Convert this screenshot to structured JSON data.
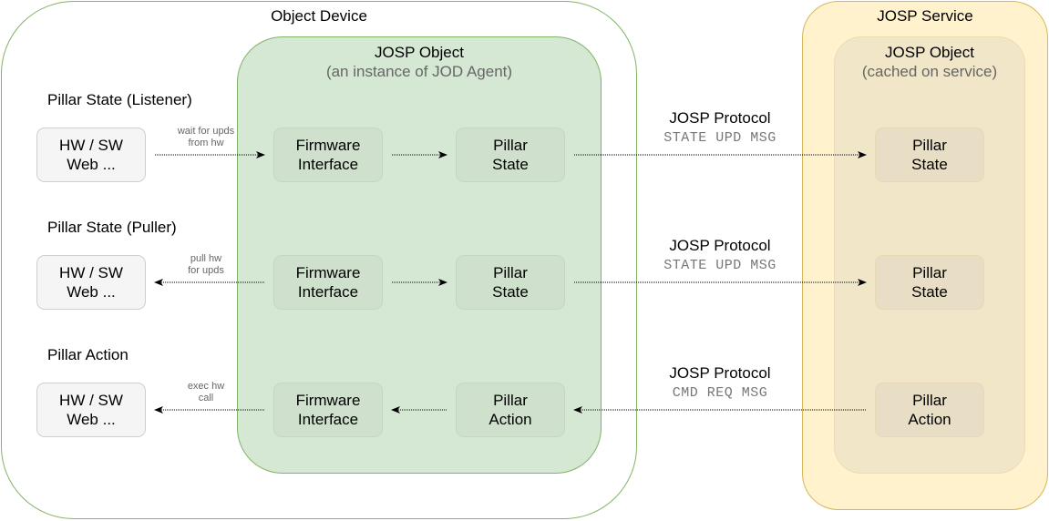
{
  "object_device": {
    "title": "Object Device"
  },
  "jod_object": {
    "title": "JOSP Object",
    "subtitle": "(an instance of JOD Agent)"
  },
  "service": {
    "title": "JOSP Service"
  },
  "cached_object": {
    "title": "JOSP Object",
    "subtitle": "(cached on service)"
  },
  "rows": [
    {
      "section": "Pillar State (Listener)",
      "hw": [
        "HW / SW",
        "Web ..."
      ],
      "hw_edge": [
        "wait for upds",
        "from hw"
      ],
      "hw_edge_direction": "to-firmware",
      "firmware": [
        "Firmware",
        "Interface"
      ],
      "pillar": [
        "Pillar",
        "State"
      ],
      "protocol": "JOSP Protocol",
      "message": "STATE UPD MSG",
      "protocol_direction": "to-service",
      "service_pillar": [
        "Pillar",
        "State"
      ]
    },
    {
      "section": "Pillar State (Puller)",
      "hw": [
        "HW / SW",
        "Web ..."
      ],
      "hw_edge": [
        "pull hw",
        "for upds"
      ],
      "hw_edge_direction": "to-hw",
      "firmware": [
        "Firmware",
        "Interface"
      ],
      "pillar": [
        "Pillar",
        "State"
      ],
      "protocol": "JOSP Protocol",
      "message": "STATE UPD MSG",
      "protocol_direction": "to-service",
      "service_pillar": [
        "Pillar",
        "State"
      ]
    },
    {
      "section": "Pillar Action",
      "hw": [
        "HW / SW",
        "Web ..."
      ],
      "hw_edge": [
        "exec hw",
        "call"
      ],
      "hw_edge_direction": "to-hw",
      "firmware": [
        "Firmware",
        "Interface"
      ],
      "pillar": [
        "Pillar",
        "Action"
      ],
      "protocol": "JOSP Protocol",
      "message": "CMD REQ MSG",
      "protocol_direction": "to-device",
      "service_pillar": [
        "Pillar",
        "Action"
      ]
    }
  ]
}
